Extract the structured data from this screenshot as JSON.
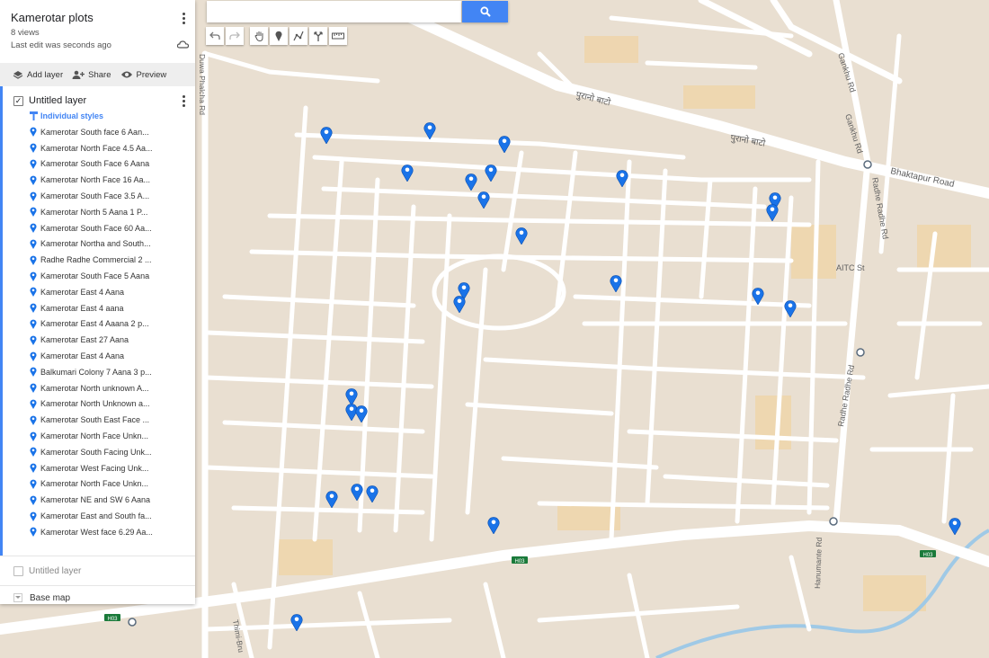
{
  "panel": {
    "title": "Kamerotar plots",
    "views": "8 views",
    "last_edit": "Last edit was seconds ago",
    "actions": {
      "add_layer": "Add layer",
      "share": "Share",
      "preview": "Preview"
    },
    "layer": {
      "name": "Untitled layer",
      "styles_link": "Individual styles",
      "places": [
        "Kamerotar South face 6 Aan...",
        "Kamerotar North Face 4.5 Aa...",
        "Kamerotar South Face 6 Aana",
        "Kamerotar North Face 16 Aa...",
        "Kamerotar South Face 3.5 A...",
        "Kamerotar North 5 Aana 1 P...",
        "Kamerotar South Face 60 Aa...",
        "Kamerotar Northa and South...",
        "Radhe Radhe Commercial 2 ...",
        "Kamerotar South Face 5 Aana",
        "Kamerotar East 4 Aana",
        "Kamerotar East 4 aana",
        "Kamerotar East 4 Aaana 2 p...",
        "Kamerotar East 27 Aana",
        "Kamerotar East 4 Aana",
        "Balkumari Colony 7 Aana 3 p...",
        "Kamerotar North unknown A...",
        "Kamerotar North Unknown a...",
        "Kamerotar South East Face ...",
        "Kamerotar North Face Unkn...",
        "Kamerotar South Facing Unk...",
        "Kamerotar West Facing Unk...",
        "Kamerotar North Face Unkn...",
        "Kamerotar NE and SW 6 Aana",
        "Kamerotar East and South fa...",
        "Kamerotar West face 6.29 Aa..."
      ]
    },
    "layer2_name": "Untitled layer",
    "base_map": "Base map"
  },
  "search": {
    "placeholder": ""
  },
  "map_labels": {
    "purano_bato": "पुरानो बाटो",
    "bhaktapur_road": "Bhaktapur Road",
    "gankhu_rd": "Gankhu Rd",
    "radhe_radhe_rd": "Radhe Radhe Rd",
    "aitc_st": "AITC St",
    "duwa_phalcha_rd": "Duwa Phalcha Rd",
    "hanumante_rd": "Hanumante Rd",
    "thimi_bru": "Thimi-Bru",
    "h03": "H03"
  },
  "colors": {
    "accent": "#4285f4",
    "marker": "#1a73e8",
    "map_bg": "#e9dfd1",
    "road": "#ffffff",
    "river": "#9fc9e6",
    "block": "#f3cf96"
  },
  "icons": [
    "kebab-menu-icon",
    "cloud-icon",
    "add-layer-icon",
    "share-icon",
    "preview-eye-icon",
    "checkbox-icon",
    "paint-style-icon",
    "place-marker-icon",
    "search-icon",
    "undo-icon",
    "redo-icon",
    "pan-hand-icon",
    "add-marker-icon",
    "draw-line-icon",
    "directions-icon",
    "ruler-icon",
    "bus-stop-icon"
  ]
}
